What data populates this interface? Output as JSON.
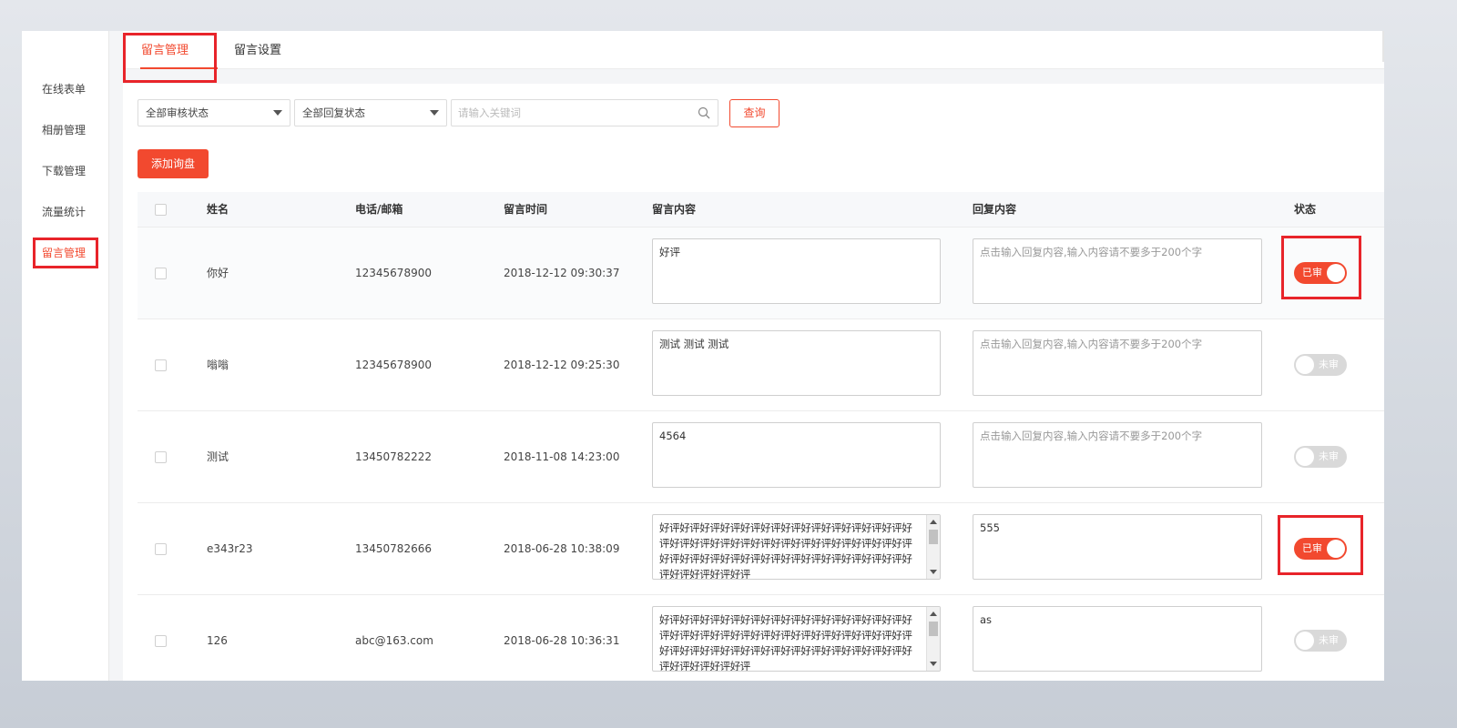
{
  "sidebar": {
    "items": [
      {
        "label": "在线表单"
      },
      {
        "label": "相册管理"
      },
      {
        "label": "下载管理"
      },
      {
        "label": "流量统计"
      },
      {
        "label": "留言管理"
      }
    ],
    "active_index": 4
  },
  "tabs": [
    {
      "label": "留言管理"
    },
    {
      "label": "留言设置"
    }
  ],
  "filters": {
    "audit_status": "全部审核状态",
    "reply_status": "全部回复状态",
    "search_placeholder": "请输入关键词",
    "query_label": "查询"
  },
  "add_button": "添加询盘",
  "table": {
    "headers": {
      "name": "姓名",
      "contact": "电话/邮箱",
      "time": "留言时间",
      "content": "留言内容",
      "reply": "回复内容",
      "status": "状态"
    },
    "reply_placeholder": "点击输入回复内容,输入内容请不要多于200个字",
    "rows": [
      {
        "name": "你好",
        "contact": "12345678900",
        "time": "2018-12-12 09:30:37",
        "content": "好评",
        "reply": "",
        "status": "已审",
        "approved": true
      },
      {
        "name": "嗡嗡",
        "contact": "12345678900",
        "time": "2018-12-12 09:25:30",
        "content": "测试  测试  测试",
        "reply": "",
        "status": "未审",
        "approved": false
      },
      {
        "name": "测试",
        "contact": "13450782222",
        "time": "2018-11-08 14:23:00",
        "content": "4564",
        "reply": "",
        "status": "未审",
        "approved": false
      },
      {
        "name": "e343r23",
        "contact": "13450782666",
        "time": "2018-06-28 10:38:09",
        "content": "好评好评好评好评好评好评好评好评好评好评好评好评好评好评好评好评好评好评好评好评好评好评好评好评好评好评好评好评好评好评好评好评好评好评好评好评好评好评好评好评好评好评",
        "reply": "555",
        "status": "已审",
        "approved": true
      },
      {
        "name": "126",
        "contact": "abc@163.com",
        "time": "2018-06-28 10:36:31",
        "content": "好评好评好评好评好评好评好评好评好评好评好评好评好评好评好评好评好评好评好评好评好评好评好评好评好评好评好评好评好评好评好评好评好评好评好评好评好评好评好评好评好评好评",
        "reply": "as",
        "status": "未审",
        "approved": false
      }
    ]
  },
  "colors": {
    "accent": "#f2492f",
    "highlight": "#e8242a",
    "toggle_off": "#d9d9d9"
  }
}
